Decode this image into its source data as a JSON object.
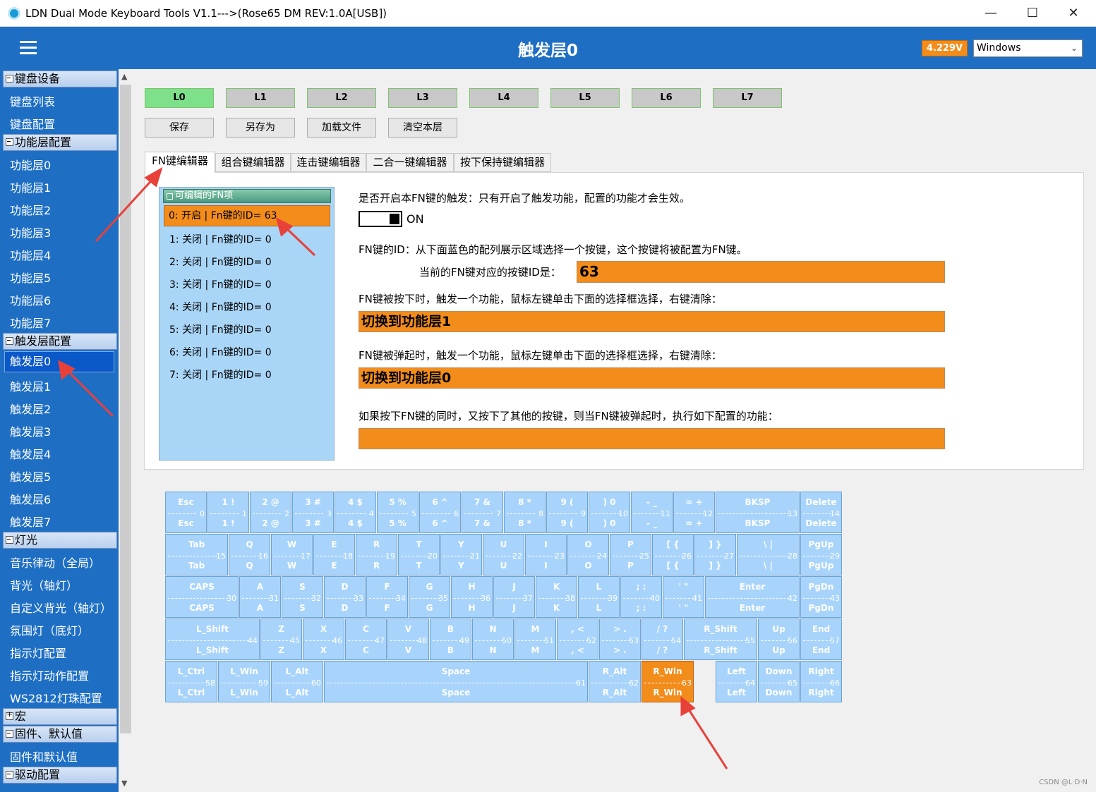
{
  "window": {
    "title": "LDN Dual Mode Keyboard Tools V1.1--->(Rose65 DM REV:1.0A[USB])",
    "minimize": "—",
    "maximize": "☐",
    "close": "✕"
  },
  "header": {
    "title": "触发层0",
    "voltage": "4.229V",
    "os": "Windows"
  },
  "sidebar": {
    "groups": [
      {
        "label": "键盘设备",
        "items": [
          "键盘列表",
          "键盘配置"
        ]
      },
      {
        "label": "功能层配置",
        "items": [
          "功能层0",
          "功能层1",
          "功能层2",
          "功能层3",
          "功能层4",
          "功能层5",
          "功能层6",
          "功能层7"
        ]
      },
      {
        "label": "触发层配置",
        "items": [
          "触发层0",
          "触发层1",
          "触发层2",
          "触发层3",
          "触发层4",
          "触发层5",
          "触发层6",
          "触发层7"
        ]
      },
      {
        "label": "灯光",
        "items": [
          "音乐律动（全局）",
          "背光（轴灯）",
          "自定义背光（轴灯）",
          "氛围灯（底灯）",
          "指示灯配置",
          "指示灯动作配置",
          "WS2812灯珠配置"
        ]
      },
      {
        "label": "宏",
        "items": []
      },
      {
        "label": "固件、默认值",
        "items": [
          "固件和默认值"
        ]
      },
      {
        "label": "驱动配置",
        "items": []
      }
    ]
  },
  "layers": [
    "L0",
    "L1",
    "L2",
    "L3",
    "L4",
    "L5",
    "L6",
    "L7"
  ],
  "actions": [
    "保存",
    "另存为",
    "加载文件",
    "清空本层"
  ],
  "tabs": [
    "FN键编辑器",
    "组合键编辑器",
    "连击键编辑器",
    "二合一键编辑器",
    "按下保持键编辑器"
  ],
  "fnlist": {
    "header": "可编辑的FN项",
    "rows": [
      "0: 开启 | Fn键的ID= 63",
      "1: 关闭 | Fn键的ID= 0",
      "2: 关闭 | Fn键的ID= 0",
      "3: 关闭 | Fn键的ID= 0",
      "4: 关闭 | Fn键的ID= 0",
      "5: 关闭 | Fn键的ID= 0",
      "6: 关闭 | Fn键的ID= 0",
      "7: 关闭 | Fn键的ID= 0"
    ]
  },
  "editor": {
    "enable_label": "是否开启本FN键的触发：只有开启了触发功能，配置的功能才会生效。",
    "toggle_state": "ON",
    "id_label": "FN键的ID：从下面蓝色的配列展示区域选择一个按键，这个按键将被配置为FN键。",
    "current_id_label": "当前的FN键对应的按键ID是：",
    "current_id": "63",
    "press_label": "FN键被按下时，触发一个功能，鼠标左键单击下面的选择框选择，右键清除：",
    "press_value": "切换到功能层1",
    "release_label": "FN键被弹起时，触发一个功能，鼠标左键单击下面的选择框选择，右键清除：",
    "release_value": "切换到功能层0",
    "combo_label": "如果按下FN键的同时，又按下了其他的按键，则当FN键被弹起时，执行如下配置的功能：",
    "combo_value": ""
  },
  "keyboard": {
    "highlight_id": 63,
    "rows": [
      [
        [
          "Esc",
          0,
          1
        ],
        [
          "1 !",
          1,
          1
        ],
        [
          "2 @",
          2,
          1
        ],
        [
          "3 #",
          3,
          1
        ],
        [
          "4 $",
          4,
          1
        ],
        [
          "5 %",
          5,
          1
        ],
        [
          "6 ^",
          6,
          1
        ],
        [
          "7 &",
          7,
          1
        ],
        [
          "8 *",
          8,
          1
        ],
        [
          "9 (",
          9,
          1
        ],
        [
          ") 0",
          10,
          1
        ],
        [
          "- _",
          11,
          1
        ],
        [
          "= +",
          12,
          1
        ],
        [
          "BKSP",
          13,
          2
        ],
        [
          "Delete",
          14,
          1
        ]
      ],
      [
        [
          "Tab",
          15,
          1.5
        ],
        [
          "Q",
          16,
          1
        ],
        [
          "W",
          17,
          1
        ],
        [
          "E",
          18,
          1
        ],
        [
          "R",
          19,
          1
        ],
        [
          "T",
          20,
          1
        ],
        [
          "Y",
          21,
          1
        ],
        [
          "U",
          22,
          1
        ],
        [
          "I",
          23,
          1
        ],
        [
          "O",
          24,
          1
        ],
        [
          "P",
          25,
          1
        ],
        [
          "[ {",
          26,
          1
        ],
        [
          "] }",
          27,
          1
        ],
        [
          "\\ |",
          28,
          1.5
        ],
        [
          "PgUp",
          29,
          1
        ]
      ],
      [
        [
          "CAPS",
          30,
          1.75
        ],
        [
          "A",
          31,
          1
        ],
        [
          "S",
          32,
          1
        ],
        [
          "D",
          33,
          1
        ],
        [
          "F",
          34,
          1
        ],
        [
          "G",
          35,
          1
        ],
        [
          "H",
          36,
          1
        ],
        [
          "J",
          37,
          1
        ],
        [
          "K",
          38,
          1
        ],
        [
          "L",
          39,
          1
        ],
        [
          "; :",
          40,
          1
        ],
        [
          "' \"",
          41,
          1
        ],
        [
          "Enter",
          42,
          2.25
        ],
        [
          "PgDn",
          43,
          1
        ]
      ],
      [
        [
          "L_Shift",
          44,
          2.25
        ],
        [
          "Z",
          45,
          1
        ],
        [
          "X",
          46,
          1
        ],
        [
          "C",
          47,
          1
        ],
        [
          "V",
          48,
          1
        ],
        [
          "B",
          49,
          1
        ],
        [
          "N",
          50,
          1
        ],
        [
          "M",
          51,
          1
        ],
        [
          ", <",
          52,
          1
        ],
        [
          "> .",
          53,
          1
        ],
        [
          "/ ?",
          54,
          1
        ],
        [
          "R_Shift",
          55,
          1.75
        ],
        [
          "Up",
          56,
          1
        ],
        [
          "End",
          57,
          1
        ]
      ],
      [
        [
          "L_Ctrl",
          58,
          1.25
        ],
        [
          "L_Win",
          59,
          1.25
        ],
        [
          "L_Alt",
          60,
          1.25
        ],
        [
          "Space",
          61,
          6.25
        ],
        [
          "R_Alt",
          62,
          1.25
        ],
        [
          "R_Win",
          63,
          1.25
        ],
        [
          "",
          -1,
          0.5
        ],
        [
          "Left",
          64,
          1
        ],
        [
          "Down",
          65,
          1
        ],
        [
          "Right",
          66,
          1
        ]
      ]
    ]
  },
  "watermark": "CSDN @L·D·N",
  "colors": {
    "accent": "#1e6fc4",
    "orange": "#f28c1b",
    "key": "#a8d4fb",
    "arrow": "#e8413a",
    "active_layer": "#7ee08a"
  }
}
